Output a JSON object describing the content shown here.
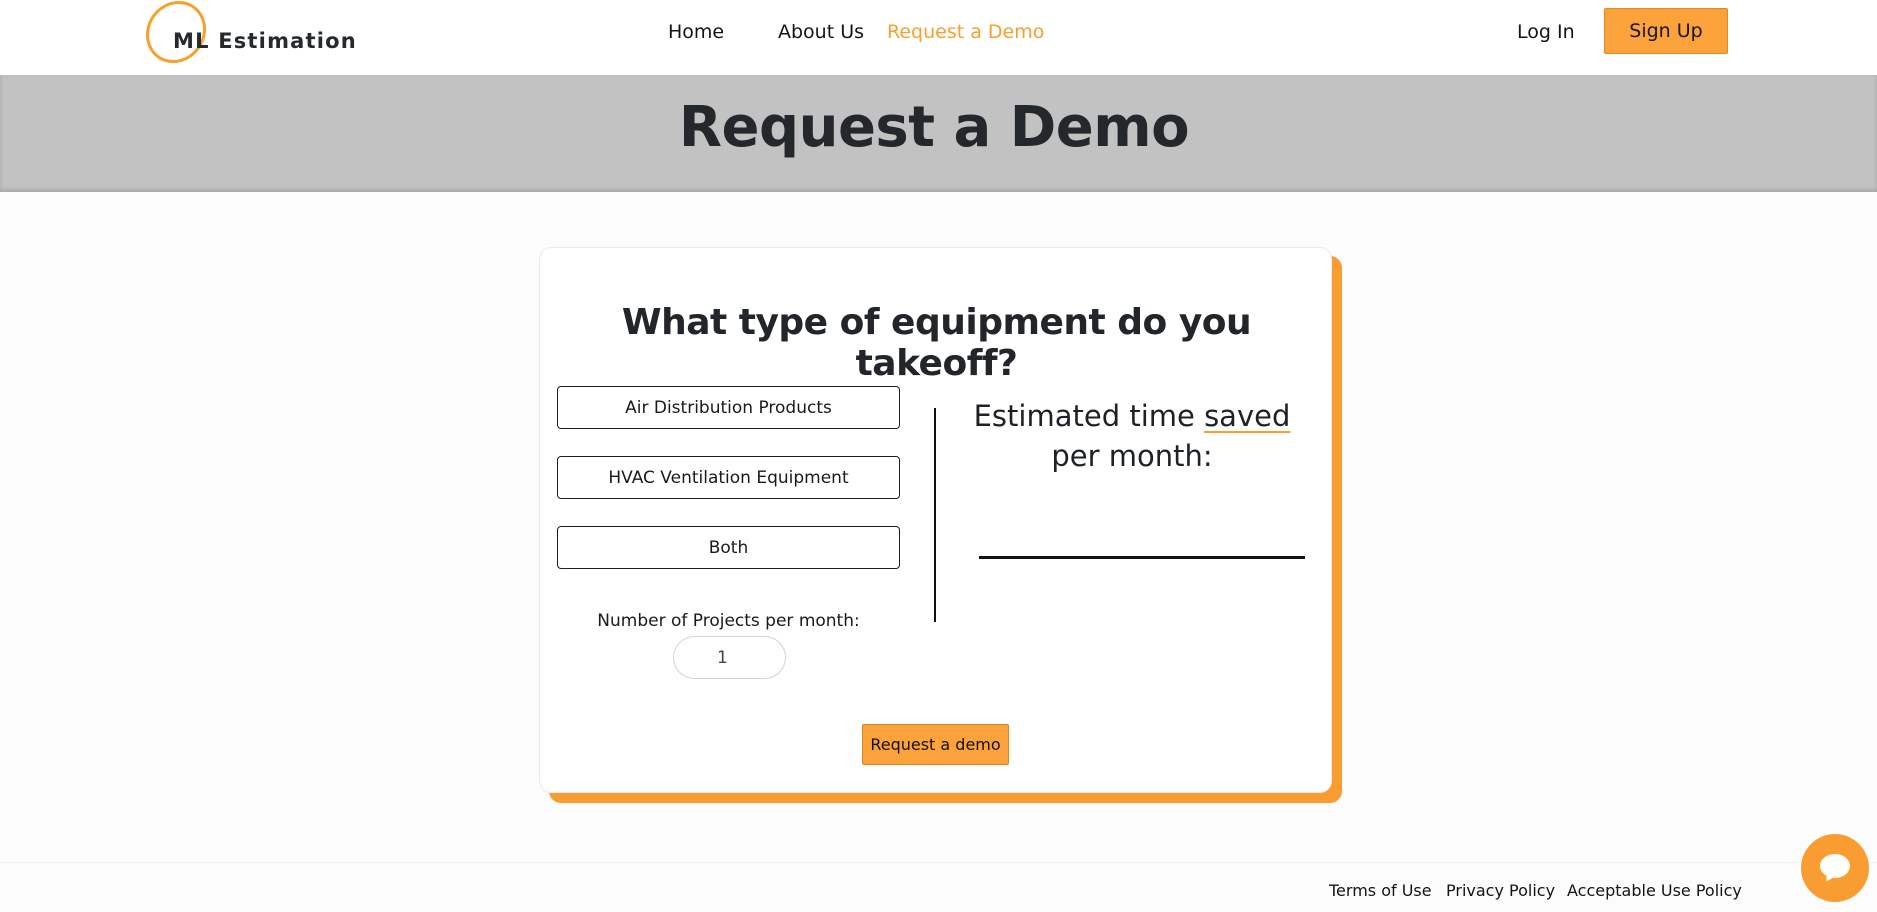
{
  "nav": {
    "logo_text": "ML Estimation",
    "links": [
      "Home",
      "About Us",
      "Request a Demo"
    ],
    "login": "Log In",
    "signup": "Sign Up"
  },
  "hero": {
    "title": "Request a Demo"
  },
  "card": {
    "question": "What type of equipment do you takeoff?",
    "options": [
      "Air Distribution Products",
      "HVAC Ventilation Equipment",
      "Both"
    ],
    "projects_label": "Number of Projects per month:",
    "projects_value": "1",
    "estimate_title_part1": "Estimated time ",
    "estimate_title_saved": "saved",
    "estimate_title_part2": "per month:",
    "submit": "Request a demo"
  },
  "footer": {
    "links": [
      "Terms of Use",
      "Privacy Policy",
      "Acceptable Use Policy"
    ]
  },
  "colors": {
    "accent": "#f7a02e",
    "hero_bg": "#c2c2c2"
  },
  "chat": {
    "icon": "chat-bubble-icon"
  }
}
